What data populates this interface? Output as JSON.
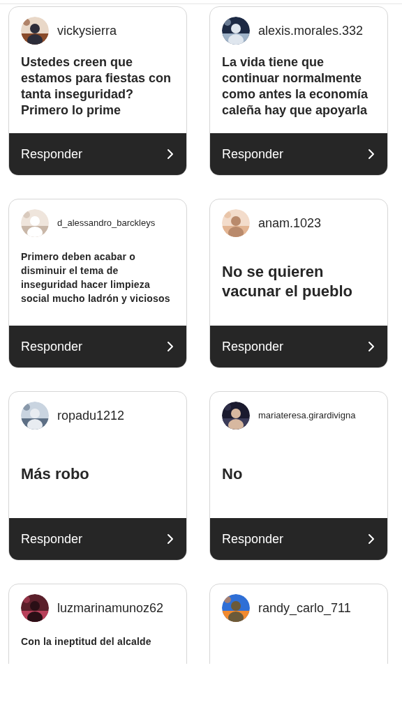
{
  "cards": [
    {
      "username": "vickysierra",
      "kind": "medium",
      "question": "Ustedes creen que estamos para fiestas con tanta inseguridad? Primero lo prime",
      "action": "Responder"
    },
    {
      "username": "alexis.morales.332",
      "kind": "medium",
      "question": "La vida tiene que continuar normalmente como antes la economía caleña hay que apoyarla",
      "action": "Responder"
    },
    {
      "username": "d_alessandro_barckleys",
      "kind": "small",
      "question": "Primero deben acabar o disminuir el tema de inseguridad hacer limpieza social mucho ladrón y viciosos",
      "action": "Responder"
    },
    {
      "username": "anam.1023",
      "kind": "large",
      "question": "No se quieren vacunar el pueblo",
      "action": "Responder"
    },
    {
      "username": "ropadu1212",
      "kind": "large",
      "question": "Más robo",
      "action": "Responder"
    },
    {
      "username": "mariateresa.girardivigna",
      "kind": "large",
      "question": "No",
      "action": "Responder"
    },
    {
      "username": "luzmarinamunoz62",
      "kind": "small",
      "question": "Con la ineptitud del alcalde"
    },
    {
      "username": "randy_carlo_711"
    }
  ]
}
